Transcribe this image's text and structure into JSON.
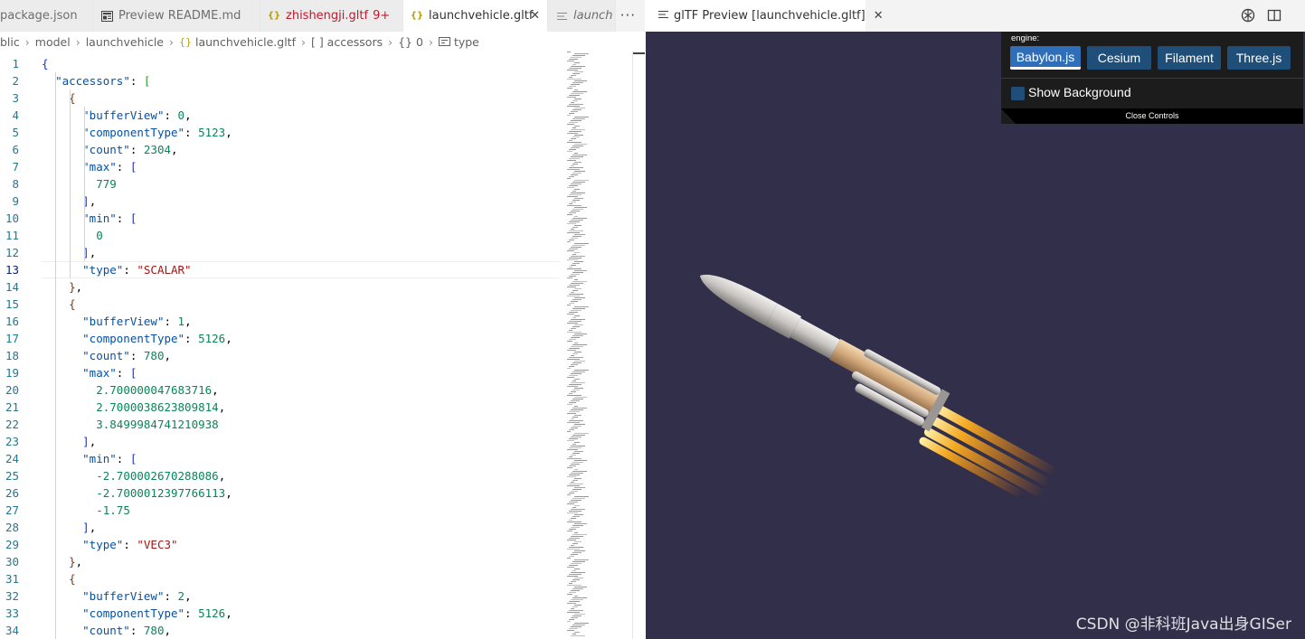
{
  "left_tabs": [
    {
      "label": "package.json",
      "icon": "none",
      "state": "inactive"
    },
    {
      "label": "Preview README.md",
      "icon": "preview-icon",
      "state": "inactive"
    },
    {
      "label": "zhishengji.gltf",
      "badge": "9+",
      "icon": "json-braces-icon",
      "state": "error"
    },
    {
      "label": "launchvehicle.gltf",
      "icon": "json-braces-icon",
      "state": "active"
    },
    {
      "label": "launch",
      "icon": "lines-icon",
      "state": "preview-italic"
    }
  ],
  "breadcrumb": [
    "blic",
    "model",
    "launchvehicle",
    "launchvehicle.gltf",
    "[ ] accessors",
    "{} 0",
    "type"
  ],
  "editor": {
    "current_line": 13,
    "lines": [
      "{",
      "  \"accessors\": [",
      "    {",
      "      \"bufferView\": 0,",
      "      \"componentType\": 5123,",
      "      \"count\": 2304,",
      "      \"max\": [",
      "        779",
      "      ],",
      "      \"min\": [",
      "        0",
      "      ],",
      "      \"type\": \"SCALAR\"",
      "    },",
      "    {",
      "      \"bufferView\": 1,",
      "      \"componentType\": 5126,",
      "      \"count\": 780,",
      "      \"max\": [",
      "        2.700000047683716,",
      "        2.7000038623809814,",
      "        3.8499984741210938",
      "      ],",
      "      \"min\": [",
      "        -2.700002670288086,",
      "        -2.7000012397766113,",
      "        -1.75",
      "      ],",
      "      \"type\": \"VEC3\"",
      "    },",
      "    {",
      "      \"bufferView\": 2,",
      "      \"componentType\": 5126,",
      "      \"count\": 780,"
    ]
  },
  "right_tab": {
    "label": "glTF Preview [launchvehicle.gltf]",
    "icon": "lines-icon"
  },
  "right_actions": [
    "gltf-icon",
    "split-editor-icon"
  ],
  "viewer": {
    "engine_label": "engine:",
    "engines": [
      "Babylon.js",
      "Cesium",
      "Filament",
      "Three.js"
    ],
    "selected_engine": "Babylon.js",
    "show_background_label": "Show Background",
    "show_background_checked": false,
    "close_controls_label": "Close Controls",
    "model_description": "launch vehicle 3D model",
    "background_color": "#312f49"
  },
  "watermark": "CSDN @非科班Java出身GISer"
}
